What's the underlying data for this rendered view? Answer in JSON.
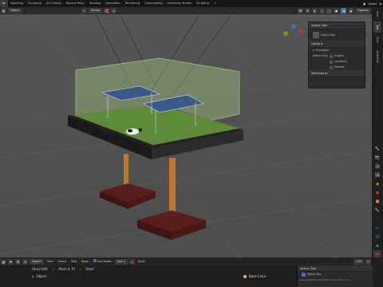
{
  "topbar": {
    "tabs": [
      "ut",
      "Modeling",
      "Sculpting",
      "UV Editing",
      "Texture Paint",
      "Shading",
      "Animation",
      "Rendering",
      "Compositing",
      "Geometry Nodes",
      "Scripting",
      "+"
    ],
    "active_index": 0,
    "scene_label": "Scene"
  },
  "header": {
    "mode": "Object",
    "global": "Global",
    "options_label": "Options"
  },
  "npanel": {
    "active_tool_title": "Active Tool",
    "select_box_label": "Select Box",
    "options_title": "Options",
    "transform_label": "Transform",
    "affect_only_label": "Affect Only",
    "origins_label": "Origins",
    "locations_label": "Locations",
    "parents_label": "Parents",
    "workspace_title": "Workspace",
    "side_tabs": [
      "Item",
      "Tool",
      "View",
      "Sketchfab"
    ]
  },
  "bottombar": {
    "object_label": "Object",
    "view_label": "View",
    "select_label": "Select",
    "add_label": "Add",
    "node_label": "Node",
    "use_nodes_label": "Use Nodes",
    "slot_label": "Slot 1",
    "material_label": "Steel",
    "frame_value": "139"
  },
  "statusbar": {
    "object_name": "Obed.009",
    "modifier_name": "Mesh.4.70",
    "material_name": "Steel",
    "object_mode_label": "Object",
    "base_color_label": "Base Color",
    "active_tool_label": "Active Tool",
    "select_box_label": "Select Box",
    "stats": "Scene Collection | Obed.009 | Verts:234,4.5 | 3.x"
  },
  "colors": {
    "accent_orange": "#e88a1a",
    "active_blue": "#4772b3",
    "viewport_bg": "#525252",
    "grass": "#5f8a3a"
  }
}
